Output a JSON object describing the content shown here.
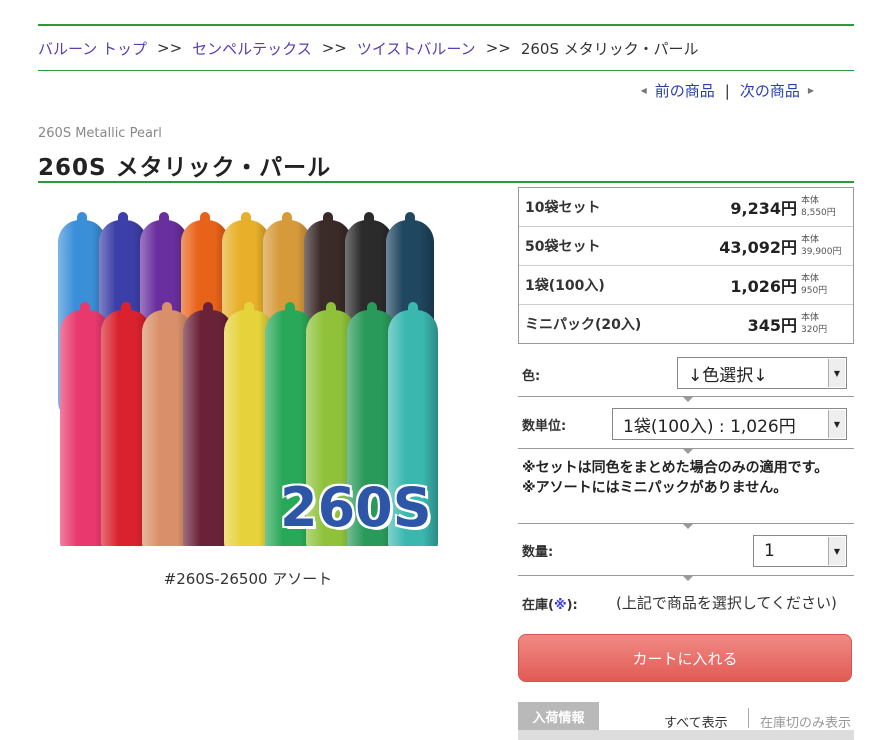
{
  "breadcrumb": {
    "items": [
      "バルーン トップ",
      "センペルテックス",
      "ツイストバルーン"
    ],
    "separator": ">>",
    "current": "260S メタリック・パール"
  },
  "nav": {
    "prev": "前の商品",
    "divider": "|",
    "next": "次の商品"
  },
  "product": {
    "subtitle": "260S Metallic Pearl",
    "title": "260S メタリック・パール",
    "image_text": "260S",
    "image_caption": "#260S-26500 アソート"
  },
  "prices": [
    {
      "name": "10袋セット",
      "price": "9,234円",
      "sub_label": "本体",
      "sub_price": "8,550円"
    },
    {
      "name": "50袋セット",
      "price": "43,092円",
      "sub_label": "本体",
      "sub_price": "39,900円"
    },
    {
      "name": "1袋(100入)",
      "price": "1,026円",
      "sub_label": "本体",
      "sub_price": "950円"
    },
    {
      "name": "ミニパック(20入)",
      "price": "345円",
      "sub_label": "本体",
      "sub_price": "320円"
    }
  ],
  "options": {
    "color_label": "色:",
    "color_value": "↓色選択↓",
    "unit_label": "数単位:",
    "unit_value": "1袋(100入) : 1,026円",
    "notice_1": "※セットは同色をまとめた場合のみの適用です。",
    "notice_2": "※アソートにはミニパックがありません。",
    "qty_label": "数量:",
    "qty_value": "1",
    "stock_label_pre": "在庫(",
    "stock_label_ast": "※",
    "stock_label_post": "):",
    "stock_message": "(上記で商品を選択してください)"
  },
  "cart_button": "カートに入れる",
  "arrival": {
    "tab": "入荷情報",
    "show_all": "すべて表示",
    "out_of_stock_only": "在庫切のみ表示"
  },
  "colors": {
    "accent_green": "#2a9a3a",
    "link_purple": "#5a3db0",
    "cart_red": "#e25a55",
    "image_text_blue": "#2d56a8"
  },
  "balloon_colors_back": [
    "#3a8fd8",
    "#3d3fa8",
    "#6a2f9e",
    "#e8631a",
    "#e8b02a",
    "#d69a3a",
    "#3a2a28",
    "#2b2b2b",
    "#1f4760"
  ],
  "balloon_colors_front": [
    "#e8386e",
    "#d9222e",
    "#d9906a",
    "#6a2238",
    "#e6d23a",
    "#2aa85a",
    "#8fc23a",
    "#2a9a5a",
    "#3ab8b0"
  ]
}
